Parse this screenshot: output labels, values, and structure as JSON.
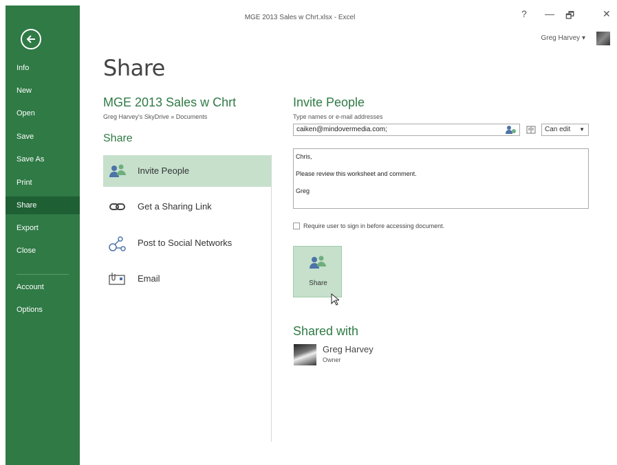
{
  "window": {
    "title": "MGE 2013 Sales w Chrt.xlsx - Excel",
    "help": "?",
    "minimize": "—",
    "restore": "🗗",
    "close": "✕",
    "user_name": "Greg Harvey"
  },
  "nav": {
    "items": [
      {
        "label": "Info"
      },
      {
        "label": "New"
      },
      {
        "label": "Open"
      },
      {
        "label": "Save"
      },
      {
        "label": "Save As"
      },
      {
        "label": "Print"
      },
      {
        "label": "Share",
        "active": true
      },
      {
        "label": "Export"
      },
      {
        "label": "Close"
      },
      {
        "label": "Account"
      },
      {
        "label": "Options"
      }
    ]
  },
  "page": {
    "title": "Share",
    "doc_name": "MGE 2013 Sales w Chrt",
    "doc_path": "Greg Harvey's SkyDrive » Documents",
    "share_heading": "Share"
  },
  "share_options": [
    {
      "label": "Invite People",
      "icon": "invite-people-icon",
      "active": true
    },
    {
      "label": "Get a Sharing Link",
      "icon": "link-icon"
    },
    {
      "label": "Post to Social Networks",
      "icon": "social-networks-icon"
    },
    {
      "label": "Email",
      "icon": "email-icon"
    }
  ],
  "invite": {
    "title": "Invite People",
    "hint": "Type names or e-mail addresses",
    "email_value": "caiken@mindovermedia.com;",
    "permission": "Can edit",
    "message_lines": [
      "Chris,",
      "Please review this worksheet and comment.",
      "Greg"
    ],
    "require_signin_label": "Require user to sign in before accessing document.",
    "require_signin_checked": false,
    "share_button": "Share"
  },
  "shared_with": {
    "title": "Shared with",
    "name": "Greg Harvey",
    "role": "Owner"
  },
  "colors": {
    "accent": "#2f7a45",
    "nav_active": "#1e5f33",
    "selected_bg": "#c6e0cc"
  }
}
